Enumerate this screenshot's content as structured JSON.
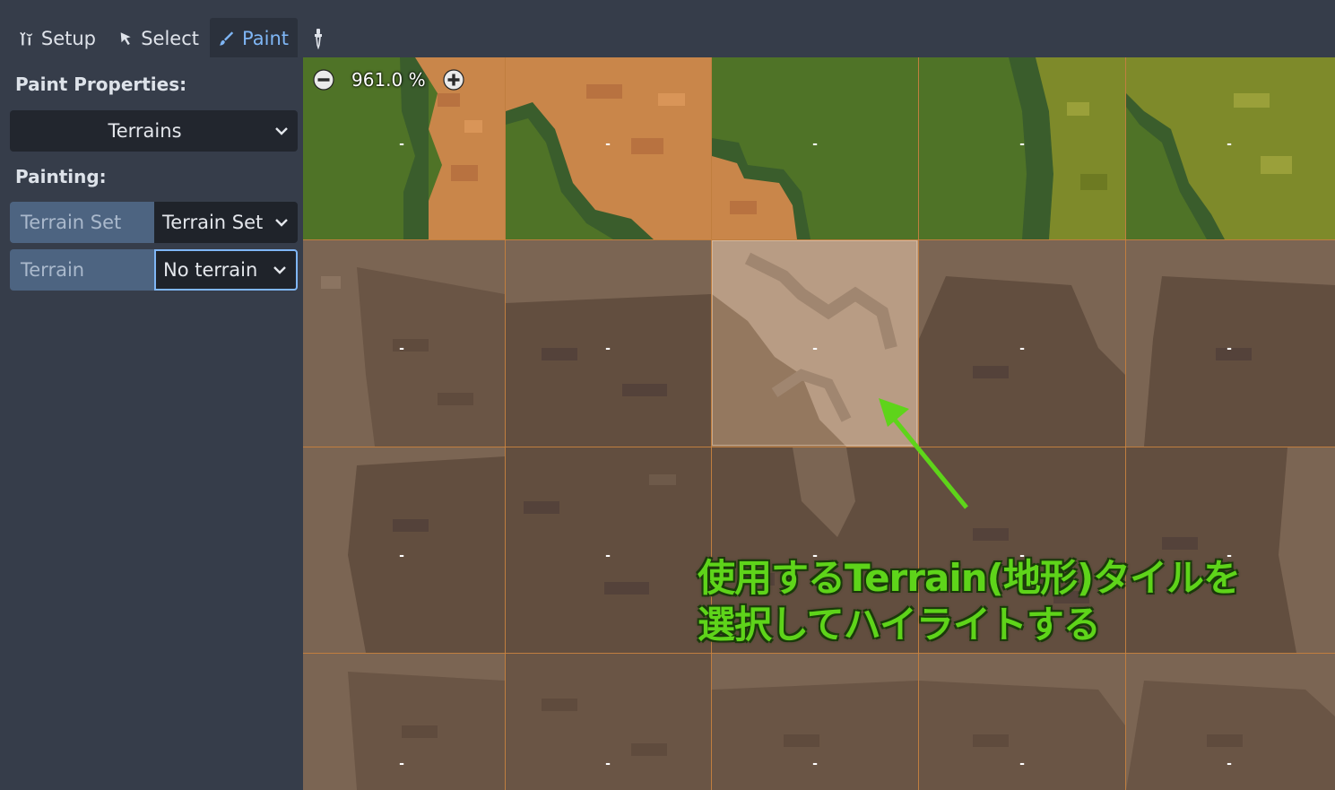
{
  "toolbar": {
    "tabs": [
      {
        "label": "Setup",
        "icon": "tools-icon"
      },
      {
        "label": "Select",
        "icon": "cursor-icon"
      },
      {
        "label": "Paint",
        "icon": "paintbrush-icon",
        "active": true
      }
    ],
    "picker_icon": "eyedropper-icon"
  },
  "panel": {
    "paint_properties_title": "Paint Properties:",
    "mode_dropdown": "Terrains",
    "painting_title": "Painting:",
    "terrain_set_label": "Terrain Set",
    "terrain_set_value": "Terrain Set",
    "terrain_label": "Terrain",
    "terrain_value": "No terrain"
  },
  "viewport": {
    "zoom": "961.0 %",
    "tile_marker": "-",
    "annotation_line1": "使用するTerrain(地形)タイルを",
    "annotation_line2": "選択してハイライトする",
    "annotation_color": "#5ed41a",
    "highlighted_tile": {
      "row": 1,
      "col": 2
    }
  },
  "colors": {
    "accent": "#7fb6f5",
    "grass": "#4f7327",
    "grass_dark": "#3a5d2c",
    "sand": "#c9864a",
    "olive": "#7e8a2a",
    "dirt": "#7b6553",
    "dirt_dark": "#5f4b3d",
    "highlight": "#b89c84"
  }
}
